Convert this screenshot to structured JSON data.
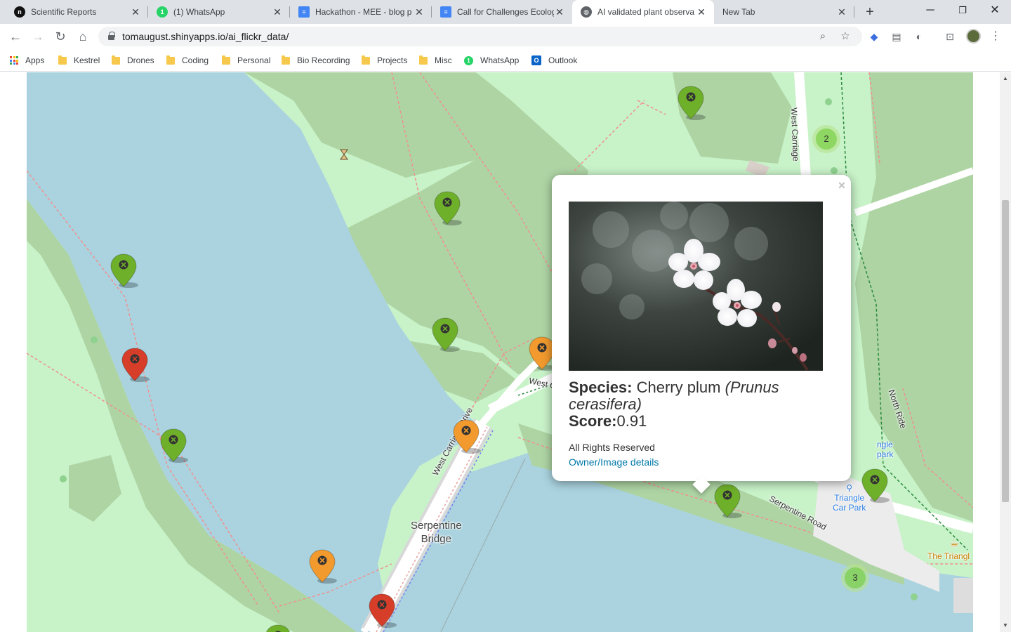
{
  "tabs": [
    {
      "title": "Scientific Reports",
      "icon": "nature-icon"
    },
    {
      "title": "(1) WhatsApp",
      "icon": "whatsapp-icon",
      "badge": "1"
    },
    {
      "title": "Hackathon - MEE - blog p",
      "icon": "docs-icon"
    },
    {
      "title": "Call for Challenges Ecolog",
      "icon": "docs-icon"
    },
    {
      "title": "AI validated plant observa",
      "icon": "globe-icon",
      "active": true
    },
    {
      "title": "New Tab",
      "icon": ""
    }
  ],
  "toolbar": {
    "url": "tomaugust.shinyapps.io/ai_flickr_data/"
  },
  "bookmarks": [
    {
      "label": "Apps",
      "icon": "apps-grid-icon"
    },
    {
      "label": "Kestrel",
      "icon": "folder-icon"
    },
    {
      "label": "Drones",
      "icon": "folder-icon"
    },
    {
      "label": "Coding",
      "icon": "folder-icon"
    },
    {
      "label": "Personal",
      "icon": "folder-icon"
    },
    {
      "label": "Bio Recording",
      "icon": "folder-icon"
    },
    {
      "label": "Projects",
      "icon": "folder-icon"
    },
    {
      "label": "Misc",
      "icon": "folder-icon"
    },
    {
      "label": "WhatsApp",
      "icon": "whatsapp-icon",
      "badge": "1"
    },
    {
      "label": "Outlook",
      "icon": "outlook-icon",
      "badge": "O"
    }
  ],
  "map": {
    "labels": {
      "serpentine_bridge_1": "Serpentine",
      "serpentine_bridge_2": "Bridge",
      "west_carriage_drive": "West Carriage Drive",
      "west_carriage_top": "West Carriage",
      "west_carriage_mid": "West Carria",
      "north_ride": "North Ride",
      "serpentine_road": "Serpentine Road",
      "triangle_car_park_1": "Triangle",
      "triangle_car_park_2": "Car Park",
      "triangle_partial_1": "ngle",
      "triangle_partial_2": "park",
      "the_triangle": "The Triangl"
    },
    "clusters": [
      {
        "count": "2"
      },
      {
        "count": "3"
      }
    ],
    "marker_colors": {
      "green": "#6fb02a",
      "orange": "#f29a2e",
      "red": "#d63e2a"
    }
  },
  "popup": {
    "species_label": "Species:",
    "species_common": "Cherry plum",
    "species_latin": "(Prunus cerasifera)",
    "score_label": "Score:",
    "score_value": "0.91",
    "rights": "All Rights Reserved",
    "owner_link": "Owner/Image details",
    "close_symbol": "×"
  }
}
